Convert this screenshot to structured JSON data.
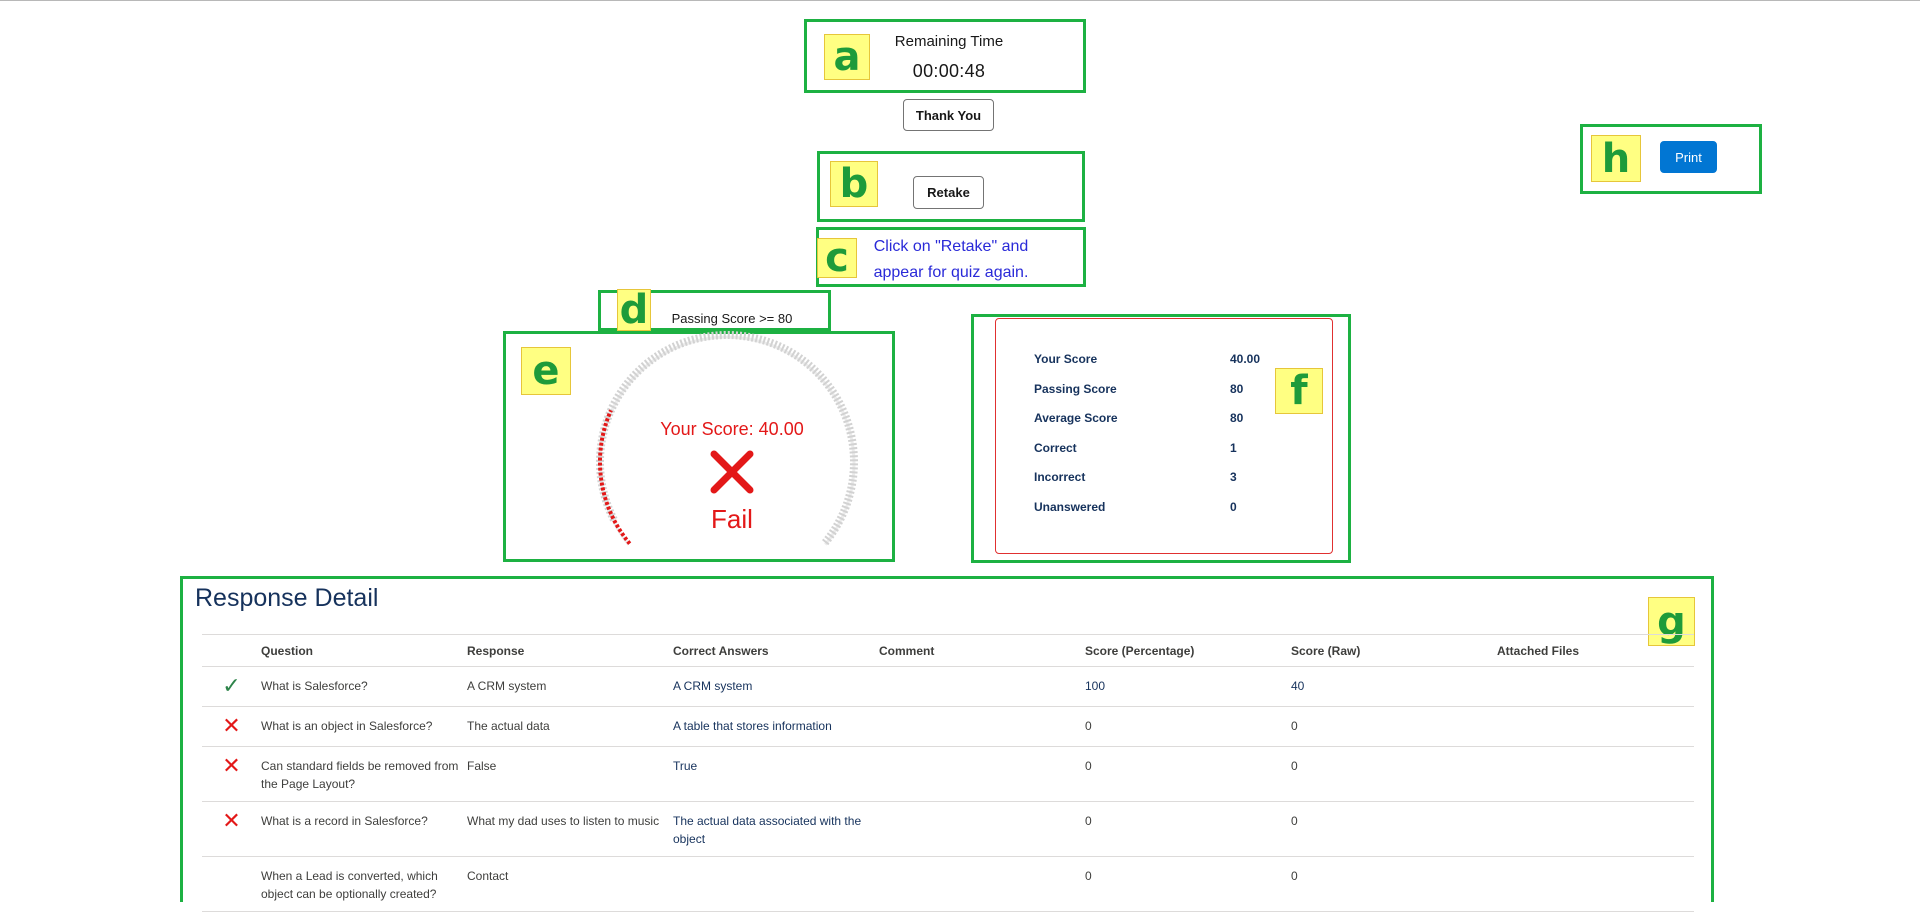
{
  "timer": {
    "label": "Remaining Time",
    "value": "00:00:48"
  },
  "buttons": {
    "thank_you": "Thank You",
    "retake": "Retake",
    "print": "Print"
  },
  "retake_message": "Click on \"Retake\" and appear for quiz again.",
  "passing_label": "Passing Score >= 80",
  "gauge": {
    "score_text": "Your Score: 40.00",
    "result": "Fail",
    "score": 40,
    "passing": 80,
    "max": 100
  },
  "summary": {
    "rows": [
      {
        "label": "Your Score",
        "value": "40.00"
      },
      {
        "label": "Passing Score",
        "value": "80"
      },
      {
        "label": "Average Score",
        "value": "80"
      },
      {
        "label": "Correct",
        "value": "1"
      },
      {
        "label": "Incorrect",
        "value": "3"
      },
      {
        "label": "Unanswered",
        "value": "0"
      }
    ]
  },
  "response_detail": {
    "title": "Response Detail",
    "columns": [
      "Question",
      "Response",
      "Correct Answers",
      "Comment",
      "Score (Percentage)",
      "Score (Raw)",
      "Attached Files"
    ],
    "rows": [
      {
        "status": "correct",
        "question": "What is Salesforce?",
        "response": "A CRM system",
        "correct": "A CRM system",
        "comment": "",
        "score_pct": "100",
        "score_raw": "40",
        "files": ""
      },
      {
        "status": "incorrect",
        "question": "What is an object in Salesforce?",
        "response": "The actual data",
        "correct": "A table that stores information",
        "comment": "",
        "score_pct": "0",
        "score_raw": "0",
        "files": ""
      },
      {
        "status": "incorrect",
        "question": "Can standard fields be removed from the Page Layout?",
        "response": "False",
        "correct": "True",
        "comment": "",
        "score_pct": "0",
        "score_raw": "0",
        "files": ""
      },
      {
        "status": "incorrect",
        "question": "What is a record in Salesforce?",
        "response": "What my dad uses to listen to music",
        "correct": "The actual data associated with the object",
        "comment": "",
        "score_pct": "0",
        "score_raw": "0",
        "files": ""
      },
      {
        "status": "none",
        "question": "When a Lead is converted, which object can be optionally created?",
        "response": "Contact",
        "correct": "",
        "comment": "",
        "score_pct": "0",
        "score_raw": "0",
        "files": ""
      }
    ]
  },
  "annotations": [
    "a",
    "b",
    "c",
    "d",
    "e",
    "f",
    "g",
    "h"
  ],
  "colors": {
    "annotation_frame": "#1db142",
    "annotation_tag": "#ffff82",
    "fail_red": "#e31818",
    "primary_blue": "#0176d3",
    "correct_green": "#2e844a"
  }
}
